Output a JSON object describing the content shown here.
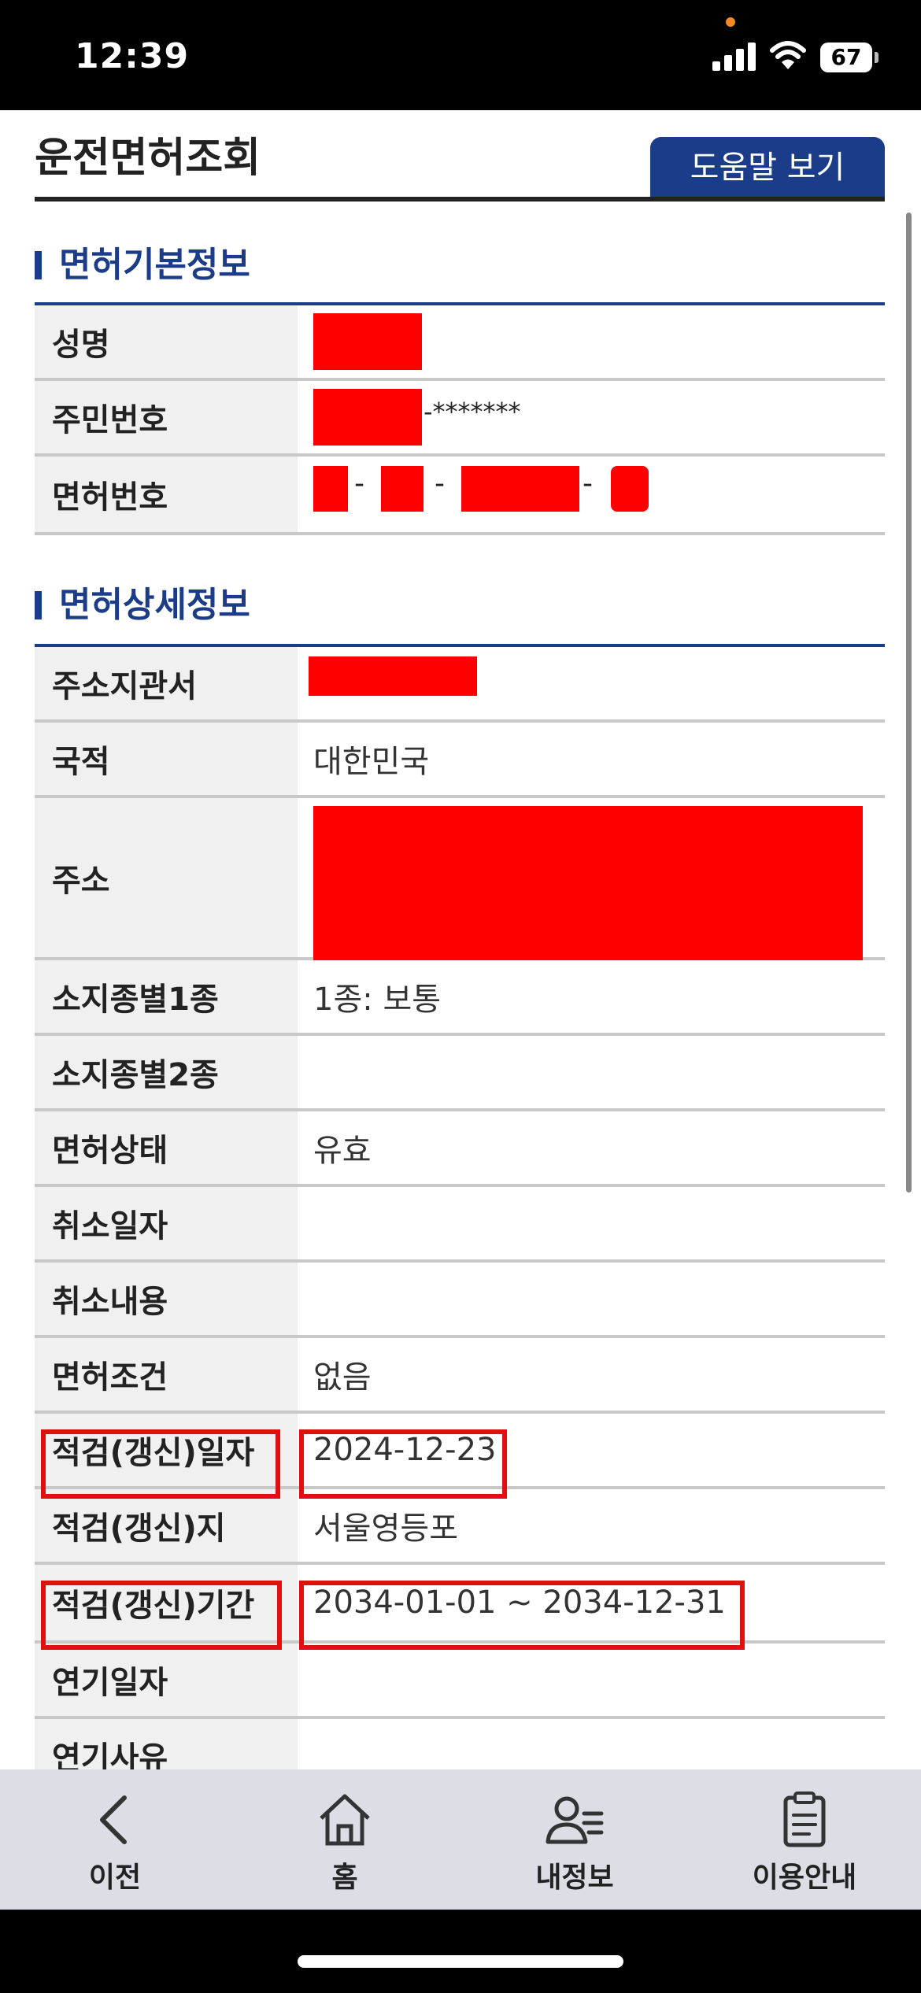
{
  "status_bar": {
    "time": "12:39",
    "battery": "67"
  },
  "header": {
    "title": "운전면허조회",
    "help_label": "도움말 보기"
  },
  "basic_section": {
    "heading": "면허기본정보",
    "rows": [
      {
        "label": "성명",
        "value": ""
      },
      {
        "label": "주민번호",
        "mask": "-*******"
      },
      {
        "label": "면허번호",
        "value": ""
      }
    ]
  },
  "detail_section": {
    "heading": "면허상세정보",
    "rows": [
      {
        "label": "주소지관서",
        "value": ""
      },
      {
        "label": "국적",
        "value": "대한민국"
      },
      {
        "label": "주소",
        "value": ""
      },
      {
        "label": "소지종별1종",
        "value": "1종:  보통"
      },
      {
        "label": "소지종별2종",
        "value": ""
      },
      {
        "label": "면허상태",
        "value": "유효"
      },
      {
        "label": "취소일자",
        "value": ""
      },
      {
        "label": "취소내용",
        "value": ""
      },
      {
        "label": "면허조건",
        "value": "없음"
      },
      {
        "label": "적검(갱신)일자",
        "value": "2024-12-23"
      },
      {
        "label": "적검(갱신)지",
        "value": "서울영등포"
      },
      {
        "label": "적검(갱신)기간",
        "value": "2034-01-01 ~ 2034-12-31"
      },
      {
        "label": "연기일자",
        "value": ""
      },
      {
        "label": "연기사유",
        "value": ""
      }
    ]
  },
  "tab_bar": {
    "items": [
      {
        "label": "이전",
        "icon": "chevron-left-icon"
      },
      {
        "label": "홈",
        "icon": "home-icon"
      },
      {
        "label": "내정보",
        "icon": "user-list-icon"
      },
      {
        "label": "이용안내",
        "icon": "clipboard-icon"
      }
    ]
  },
  "colors": {
    "accent": "#1b3c88",
    "redaction": "#ff0000",
    "highlight": "#e01010"
  }
}
